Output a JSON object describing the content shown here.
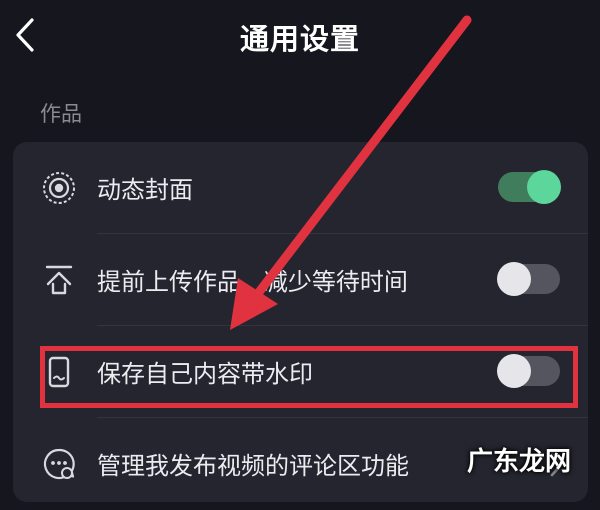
{
  "header": {
    "title": "通用设置",
    "back_icon": "chevron-left-icon"
  },
  "section": {
    "label": "作品"
  },
  "settings": [
    {
      "label": "动态封面",
      "icon": "live-cover-icon",
      "control": "toggle",
      "on": true
    },
    {
      "label": "提前上传作品   减少等待时间",
      "icon": "upload-icon",
      "control": "toggle",
      "on": false
    },
    {
      "label": "保存自己内容带水印",
      "icon": "phone-watermark-icon",
      "control": "toggle",
      "on": false
    },
    {
      "label": "管理我发布视频的评论区功能",
      "icon": "comment-settings-icon",
      "control": "chevron"
    }
  ],
  "annotation": {
    "highlight_color": "#e0333f"
  },
  "watermark": {
    "text": "广东龙网"
  },
  "colors": {
    "background": "#16161e",
    "card": "#25252f",
    "toggle_on_track": "#3f7d5d",
    "toggle_on_knob": "#5cd69a",
    "toggle_off_track": "#55555f"
  }
}
